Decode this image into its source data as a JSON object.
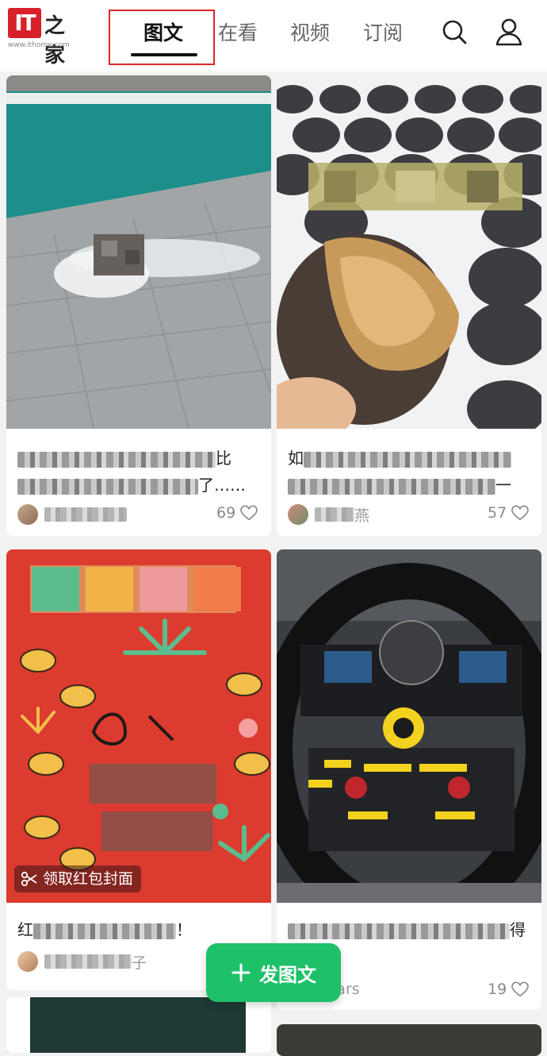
{
  "header": {
    "logo_mark": "IT",
    "logo_cn": "之家",
    "logo_url": "www.ithome.com",
    "tabs": [
      {
        "label": "图文",
        "active": true
      },
      {
        "label": "在看",
        "active": false
      },
      {
        "label": "视频",
        "active": false
      },
      {
        "label": "订阅",
        "active": false
      }
    ],
    "search_icon": "search-icon",
    "profile_icon": "user-icon"
  },
  "cards": [
    {
      "title_line1_tail": "比",
      "title_line2_tail": "了……",
      "likes": "69"
    },
    {
      "title_line1_head": "如",
      "title_line2_tail": "一",
      "likes": "57",
      "author_tail": "燕"
    },
    {
      "title_line1_head": "红",
      "title_line1_tail": "！",
      "author_tail": "子",
      "badge": "领取红包封面"
    },
    {
      "title_line1_tail": "得",
      "author_tail": "nCars",
      "likes": "19"
    }
  ],
  "fab": {
    "label": "发图文",
    "icon": "plus-icon"
  },
  "colors": {
    "accent": "#1ec06a",
    "brand": "#d8202a",
    "highlight": "#e0262b"
  }
}
